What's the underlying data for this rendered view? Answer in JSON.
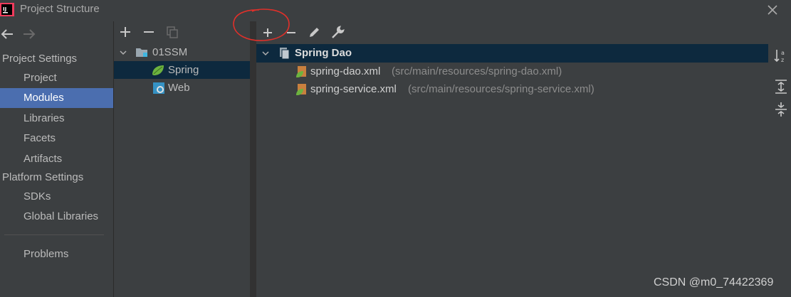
{
  "window": {
    "title": "Project Structure"
  },
  "sidebar": {
    "project_settings_header": "Project Settings",
    "project_items": [
      "Project",
      "Modules",
      "Libraries",
      "Facets",
      "Artifacts"
    ],
    "platform_settings_header": "Platform Settings",
    "platform_items": [
      "SDKs",
      "Global Libraries"
    ],
    "problems": "Problems",
    "selected": "Modules"
  },
  "modules_tree": {
    "root": "01SSM",
    "children": [
      {
        "label": "Spring",
        "icon": "spring-leaf-icon",
        "selected": true
      },
      {
        "label": "Web",
        "icon": "web-icon",
        "selected": false
      }
    ]
  },
  "detail": {
    "context_name": "Spring Dao",
    "files": [
      {
        "name": "spring-dao.xml",
        "path": "(src/main/resources/spring-dao.xml)"
      },
      {
        "name": "spring-service.xml",
        "path": "(src/main/resources/spring-service.xml)"
      }
    ]
  },
  "watermark": "CSDN @m0_74422369",
  "colors": {
    "background": "#3c3f41",
    "selection_blue": "#4b6eaf",
    "tree_selection": "#0d293e",
    "annotation_red": "#e0302a"
  }
}
